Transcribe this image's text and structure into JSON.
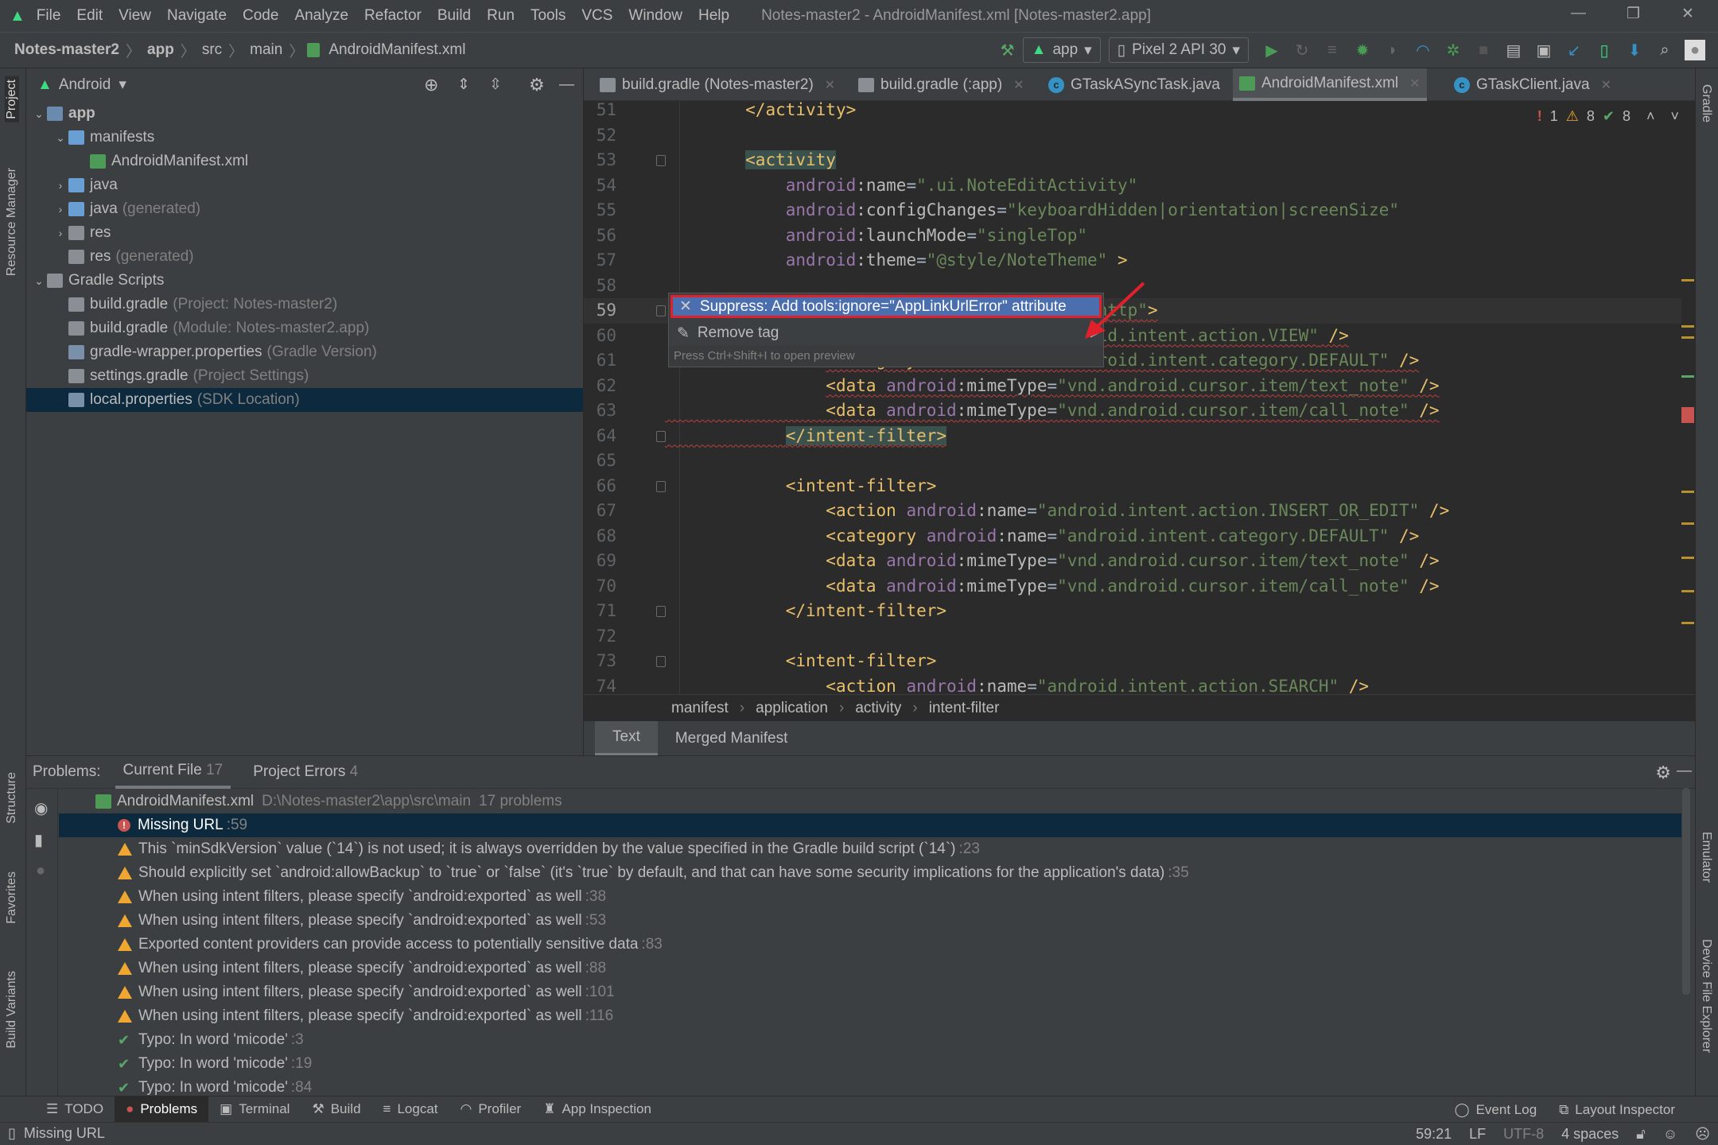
{
  "window": {
    "title": "Notes-master2 - AndroidManifest.xml [Notes-master2.app]"
  },
  "menu": [
    "File",
    "Edit",
    "View",
    "Navigate",
    "Code",
    "Analyze",
    "Refactor",
    "Build",
    "Run",
    "Tools",
    "VCS",
    "Window",
    "Help"
  ],
  "breadcrumb": [
    "Notes-master2",
    "app",
    "src",
    "main",
    "AndroidManifest.xml"
  ],
  "toolbar": {
    "run_config": "app",
    "device": "Pixel 2 API 30"
  },
  "left_stripe": [
    "Project",
    "Resource Manager",
    "Structure",
    "Favorites",
    "Build Variants"
  ],
  "right_stripe": [
    "Gradle",
    "Emulator",
    "Device File Explorer"
  ],
  "project": {
    "view": "Android",
    "items": [
      {
        "label": "app",
        "suffix": "",
        "level": 0,
        "expand": "open",
        "icon": "module",
        "bold": true
      },
      {
        "label": "manifests",
        "suffix": "",
        "level": 1,
        "expand": "open",
        "icon": "folder"
      },
      {
        "label": "AndroidManifest.xml",
        "suffix": "",
        "level": 2,
        "expand": "",
        "icon": "manifest"
      },
      {
        "label": "java",
        "suffix": "",
        "level": 1,
        "expand": "closed",
        "icon": "folder"
      },
      {
        "label": "java",
        "suffix": "(generated)",
        "level": 1,
        "expand": "closed",
        "icon": "folder-gen"
      },
      {
        "label": "res",
        "suffix": "",
        "level": 1,
        "expand": "closed",
        "icon": "folder-res"
      },
      {
        "label": "res",
        "suffix": "(generated)",
        "level": 1,
        "expand": "",
        "icon": "folder-res"
      },
      {
        "label": "Gradle Scripts",
        "suffix": "",
        "level": 0,
        "expand": "open",
        "icon": "gradle"
      },
      {
        "label": "build.gradle",
        "suffix": "(Project: Notes-master2)",
        "level": 1,
        "expand": "",
        "icon": "gradle"
      },
      {
        "label": "build.gradle",
        "suffix": "(Module: Notes-master2.app)",
        "level": 1,
        "expand": "",
        "icon": "gradle"
      },
      {
        "label": "gradle-wrapper.properties",
        "suffix": "(Gradle Version)",
        "level": 1,
        "expand": "",
        "icon": "properties"
      },
      {
        "label": "settings.gradle",
        "suffix": "(Project Settings)",
        "level": 1,
        "expand": "",
        "icon": "gradle"
      },
      {
        "label": "local.properties",
        "suffix": "(SDK Location)",
        "level": 1,
        "expand": "",
        "icon": "properties",
        "selected": true
      }
    ]
  },
  "editor": {
    "tabs": [
      {
        "label": "build.gradle (Notes-master2)",
        "icon": "gradle"
      },
      {
        "label": "build.gradle (:app)",
        "icon": "gradle"
      },
      {
        "label": "GTaskASyncTask.java",
        "icon": "class"
      },
      {
        "label": "AndroidManifest.xml",
        "icon": "manifest",
        "active": true
      },
      {
        "label": "GTaskClient.java",
        "icon": "class"
      }
    ],
    "inspection": {
      "errors": "1",
      "warnings": "8",
      "typos": "8"
    },
    "lines": [
      {
        "n": "51",
        "tokens": [
          [
            "t",
            "        "
          ],
          [
            "tag",
            "</activity>"
          ]
        ]
      },
      {
        "n": "52",
        "tokens": []
      },
      {
        "n": "53",
        "fold": true,
        "tokens": [
          [
            "t",
            "        "
          ],
          [
            "tag hl",
            "<activity"
          ]
        ]
      },
      {
        "n": "54",
        "tokens": [
          [
            "t",
            "            "
          ],
          [
            "ns",
            "android"
          ],
          [
            "attr",
            ":name"
          ],
          [
            "t",
            "="
          ],
          [
            "val",
            "\".ui.NoteEditActivity\""
          ]
        ]
      },
      {
        "n": "55",
        "tokens": [
          [
            "t",
            "            "
          ],
          [
            "ns",
            "android"
          ],
          [
            "attr",
            ":configChanges"
          ],
          [
            "t",
            "="
          ],
          [
            "val",
            "\"keyboardHidden|orientation|screenSize\""
          ]
        ]
      },
      {
        "n": "56",
        "tokens": [
          [
            "t",
            "            "
          ],
          [
            "ns",
            "android"
          ],
          [
            "attr",
            ":launchMode"
          ],
          [
            "t",
            "="
          ],
          [
            "val",
            "\"singleTop\""
          ]
        ]
      },
      {
        "n": "57",
        "tokens": [
          [
            "t",
            "            "
          ],
          [
            "ns",
            "android"
          ],
          [
            "attr",
            ":theme"
          ],
          [
            "t",
            "="
          ],
          [
            "val",
            "\"@style/NoteTheme\""
          ],
          [
            "tag",
            " >"
          ]
        ]
      },
      {
        "n": "58",
        "tokens": []
      },
      {
        "n": "59",
        "fold": true,
        "current": true,
        "tokens": [
          [
            "t",
            "            "
          ],
          [
            "tag hl err",
            "<intent-filter"
          ],
          [
            "tag err",
            " "
          ],
          [
            "ns err",
            "android"
          ],
          [
            "attr err",
            ":scheme"
          ],
          [
            "t err",
            "="
          ],
          [
            "val err",
            "\"http\""
          ],
          [
            "tag err",
            ">"
          ]
        ]
      },
      {
        "n": "60",
        "tokens": [
          [
            "t",
            "                "
          ],
          [
            "tag err",
            "<action "
          ],
          [
            "ns err",
            "android"
          ],
          [
            "attr err",
            ":name"
          ],
          [
            "t err",
            "="
          ],
          [
            "val err",
            "\"android.intent.action.VIEW\""
          ],
          [
            "tag err",
            " />"
          ]
        ]
      },
      {
        "n": "61",
        "tokens": [
          [
            "t",
            "                "
          ],
          [
            "tag err",
            "<category "
          ],
          [
            "ns err",
            "android"
          ],
          [
            "attr err",
            ":name"
          ],
          [
            "t err",
            "="
          ],
          [
            "val err",
            "\"android.intent.category.DEFAULT\""
          ],
          [
            "tag err",
            " />"
          ]
        ]
      },
      {
        "n": "62",
        "tokens": [
          [
            "t",
            "                "
          ],
          [
            "tag err",
            "<data "
          ],
          [
            "ns err",
            "android"
          ],
          [
            "attr err",
            ":mimeType"
          ],
          [
            "t err",
            "="
          ],
          [
            "val err",
            "\"vnd.android.cursor.item/text_note\""
          ],
          [
            "tag err",
            " />"
          ]
        ]
      },
      {
        "n": "63",
        "tokens": [
          [
            "t err",
            "                "
          ],
          [
            "tag err",
            "<data "
          ],
          [
            "ns err",
            "android"
          ],
          [
            "attr err",
            ":mimeType"
          ],
          [
            "t err",
            "="
          ],
          [
            "val err",
            "\"vnd.android.cursor.item/call_note\""
          ],
          [
            "tag err",
            " />"
          ]
        ]
      },
      {
        "n": "64",
        "fold": true,
        "tokens": [
          [
            "t err",
            "            "
          ],
          [
            "tag hl err",
            "</intent-filter>"
          ]
        ]
      },
      {
        "n": "65",
        "tokens": []
      },
      {
        "n": "66",
        "fold": true,
        "tokens": [
          [
            "t",
            "            "
          ],
          [
            "tag",
            "<intent-filter>"
          ]
        ]
      },
      {
        "n": "67",
        "tokens": [
          [
            "t",
            "                "
          ],
          [
            "tag",
            "<action "
          ],
          [
            "ns",
            "android"
          ],
          [
            "attr",
            ":name"
          ],
          [
            "t",
            "="
          ],
          [
            "val",
            "\"android.intent.action.INSERT_OR_EDIT\""
          ],
          [
            "tag",
            " />"
          ]
        ]
      },
      {
        "n": "68",
        "tokens": [
          [
            "t",
            "                "
          ],
          [
            "tag",
            "<category "
          ],
          [
            "ns",
            "android"
          ],
          [
            "attr",
            ":name"
          ],
          [
            "t",
            "="
          ],
          [
            "val",
            "\"android.intent.category.DEFAULT\""
          ],
          [
            "tag",
            " />"
          ]
        ]
      },
      {
        "n": "69",
        "tokens": [
          [
            "t",
            "                "
          ],
          [
            "tag",
            "<data "
          ],
          [
            "ns",
            "android"
          ],
          [
            "attr",
            ":mimeType"
          ],
          [
            "t",
            "="
          ],
          [
            "val",
            "\"vnd.android.cursor.item/text_note\""
          ],
          [
            "tag",
            " />"
          ]
        ]
      },
      {
        "n": "70",
        "tokens": [
          [
            "t",
            "                "
          ],
          [
            "tag",
            "<data "
          ],
          [
            "ns",
            "android"
          ],
          [
            "attr",
            ":mimeType"
          ],
          [
            "t",
            "="
          ],
          [
            "val",
            "\"vnd.android.cursor.item/call_note\""
          ],
          [
            "tag",
            " />"
          ]
        ]
      },
      {
        "n": "71",
        "fold": true,
        "tokens": [
          [
            "t",
            "            "
          ],
          [
            "tag",
            "</intent-filter>"
          ]
        ]
      },
      {
        "n": "72",
        "tokens": []
      },
      {
        "n": "73",
        "fold": true,
        "tokens": [
          [
            "t",
            "            "
          ],
          [
            "tag",
            "<intent-filter>"
          ]
        ]
      },
      {
        "n": "74",
        "tokens": [
          [
            "t",
            "                "
          ],
          [
            "tag",
            "<action "
          ],
          [
            "ns",
            "android"
          ],
          [
            "attr",
            ":name"
          ],
          [
            "t",
            "="
          ],
          [
            "val",
            "\"android.intent.action.SEARCH\""
          ],
          [
            "tag",
            " />"
          ]
        ]
      }
    ],
    "popup": {
      "suggestion": "Suppress: Add tools:ignore=\"AppLinkUrlError\" attribute",
      "remove_tag": "Remove tag",
      "hint": "Press Ctrl+Shift+I to open preview"
    },
    "xml_breadcrumb": [
      "manifest",
      "application",
      "activity",
      "intent-filter"
    ],
    "file_tabs": [
      "Text",
      "Merged Manifest"
    ]
  },
  "problems": {
    "label": "Problems:",
    "tabs": [
      {
        "label": "Current File",
        "count": "17",
        "active": true
      },
      {
        "label": "Project Errors",
        "count": "4"
      }
    ],
    "file": {
      "name": "AndroidManifest.xml",
      "path": "D:\\Notes-master2\\app\\src\\main",
      "count": "17 problems"
    },
    "items": [
      {
        "type": "error",
        "text": "Missing URL",
        "line": ":59",
        "selected": true
      },
      {
        "type": "warning",
        "text": "This `minSdkVersion` value (`14`) is not used; it is always overridden by the value specified in the Gradle build script (`14`)",
        "line": ":23"
      },
      {
        "type": "warning",
        "text": "Should explicitly set `android:allowBackup` to `true` or `false` (it's `true` by default, and that can have some security implications for the application's data)",
        "line": ":35"
      },
      {
        "type": "warning",
        "text": "When using intent filters, please specify `android:exported` as well",
        "line": ":38"
      },
      {
        "type": "warning",
        "text": "When using intent filters, please specify `android:exported` as well",
        "line": ":53"
      },
      {
        "type": "warning",
        "text": "Exported content providers can provide access to potentially sensitive data",
        "line": ":83"
      },
      {
        "type": "warning",
        "text": "When using intent filters, please specify `android:exported` as well",
        "line": ":88"
      },
      {
        "type": "warning",
        "text": "When using intent filters, please specify `android:exported` as well",
        "line": ":101"
      },
      {
        "type": "warning",
        "text": "When using intent filters, please specify `android:exported` as well",
        "line": ":116"
      },
      {
        "type": "typo",
        "text": "Typo: In word 'micode'",
        "line": ":3"
      },
      {
        "type": "typo",
        "text": "Typo: In word 'micode'",
        "line": ":19"
      },
      {
        "type": "typo",
        "text": "Typo: In word 'micode'",
        "line": ":84"
      }
    ]
  },
  "bottom_tools": [
    {
      "label": "TODO",
      "icon": "list"
    },
    {
      "label": "Problems",
      "icon": "error",
      "active": true
    },
    {
      "label": "Terminal",
      "icon": "terminal"
    },
    {
      "label": "Build",
      "icon": "hammer"
    },
    {
      "label": "Logcat",
      "icon": "logcat"
    },
    {
      "label": "Profiler",
      "icon": "gauge"
    },
    {
      "label": "App Inspection",
      "icon": "inspect"
    }
  ],
  "bottom_right_tools": [
    {
      "label": "Event Log",
      "icon": "bubble"
    },
    {
      "label": "Layout Inspector",
      "icon": "layout"
    }
  ],
  "status": {
    "message": "Missing URL",
    "position": "59:21",
    "line_sep": "LF",
    "encoding": "UTF-8",
    "indent": "4 spaces"
  },
  "colors": {
    "accent": "#4B6EAF",
    "error": "#C75450",
    "warning": "#F0A732",
    "highlight_box": "#E0202A",
    "android_green": "#3DDC84"
  }
}
